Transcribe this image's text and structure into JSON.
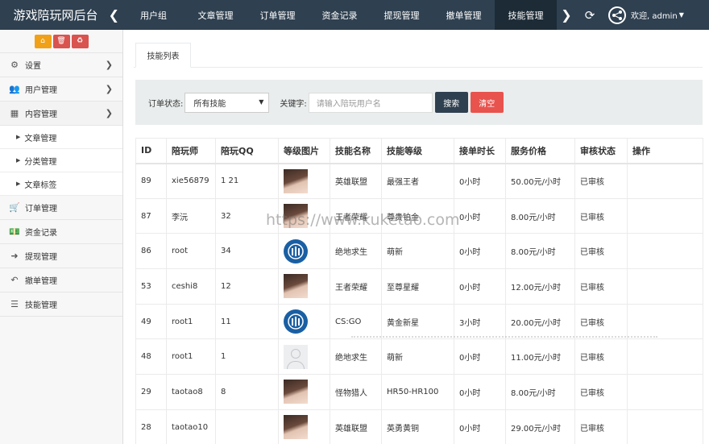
{
  "header": {
    "title": "游戏陪玩网后台",
    "collapse_icon": "chevron-left-icon",
    "nav": [
      {
        "label": "用户组",
        "active": false
      },
      {
        "label": "文章管理",
        "active": false
      },
      {
        "label": "订单管理",
        "active": false
      },
      {
        "label": "资金记录",
        "active": false
      },
      {
        "label": "提现管理",
        "active": false
      },
      {
        "label": "撤单管理",
        "active": false
      },
      {
        "label": "技能管理",
        "active": true
      }
    ],
    "user_greeting": "欢迎, admin",
    "colors": {
      "topbar": "#2f4050",
      "active_tab": "#1c2b36"
    }
  },
  "sidebar": {
    "tools": [
      "home-icon",
      "trash-icon",
      "recycle-icon"
    ],
    "items": [
      {
        "label": "设置",
        "icon": "gears-icon"
      },
      {
        "label": "用户管理",
        "icon": "users-icon"
      },
      {
        "label": "内容管理",
        "icon": "grid-icon"
      },
      {
        "label": "文章管理",
        "icon": "caret-right-icon"
      },
      {
        "label": "分类管理",
        "icon": "caret-right-icon"
      },
      {
        "label": "文章标签",
        "icon": "caret-right-icon"
      },
      {
        "label": "订单管理",
        "icon": "cart-icon"
      },
      {
        "label": "资金记录",
        "icon": "money-icon"
      },
      {
        "label": "提现管理",
        "icon": "sign-out-icon"
      },
      {
        "label": "撤单管理",
        "icon": "undo-icon"
      },
      {
        "label": "技能管理",
        "icon": "list-icon"
      }
    ]
  },
  "main": {
    "tab": "技能列表",
    "filter": {
      "status_label": "订单状态:",
      "status_value": "所有技能",
      "keyword_label": "关键字:",
      "keyword_placeholder": "请输入陪玩用户名",
      "search_button": "搜索",
      "clear_button": "清空"
    },
    "table": {
      "columns": [
        "ID",
        "陪玩师",
        "陪玩QQ",
        "等级图片",
        "技能名称",
        "技能等级",
        "接单时长",
        "服务价格",
        "审核状态",
        "操作"
      ],
      "rows": [
        {
          "id": "89",
          "player": "xie56879",
          "qq": "1        21",
          "img": "photo",
          "skill": "英雄联盟",
          "level": "最强王者",
          "duration": "0小时",
          "price": "50.00元/小时",
          "status": "已审核"
        },
        {
          "id": "87",
          "player": "李沅",
          "qq": "32",
          "img": "photo",
          "skill": "王者荣耀",
          "level": "尊贵铂金",
          "duration": "0小时",
          "price": "8.00元/小时",
          "status": "已审核"
        },
        {
          "id": "86",
          "player": "root",
          "qq": "34",
          "img": "logo",
          "skill": "绝地求生",
          "level": "萌新",
          "duration": "0小时",
          "price": "8.00元/小时",
          "status": "已审核"
        },
        {
          "id": "53",
          "player": "ceshi8",
          "qq": "12",
          "img": "photo",
          "skill": "王者荣耀",
          "level": "至尊星耀",
          "duration": "0小时",
          "price": "12.00元/小时",
          "status": "已审核"
        },
        {
          "id": "49",
          "player": "root1",
          "qq": "11",
          "img": "logo",
          "skill": "CS:GO",
          "level": "黄金新星",
          "duration": "3小时",
          "price": "20.00元/小时",
          "status": "已审核"
        },
        {
          "id": "48",
          "player": "root1",
          "qq": "1",
          "img": "default",
          "skill": "绝地求生",
          "level": "萌新",
          "duration": "0小时",
          "price": "11.00元/小时",
          "status": "已审核"
        },
        {
          "id": "29",
          "player": "taotao8",
          "qq": "8",
          "img": "photo",
          "skill": "怪物猎人",
          "level": "HR50-HR100",
          "duration": "0小时",
          "price": "8.00元/小时",
          "status": "已审核"
        },
        {
          "id": "28",
          "player": "taotao10",
          "qq": "",
          "img": "photo",
          "skill": "英雄联盟",
          "level": "英勇黄铜",
          "duration": "0小时",
          "price": "29.00元/小时",
          "status": "已审核"
        }
      ]
    }
  },
  "watermark": "https://www.kuketao.com"
}
